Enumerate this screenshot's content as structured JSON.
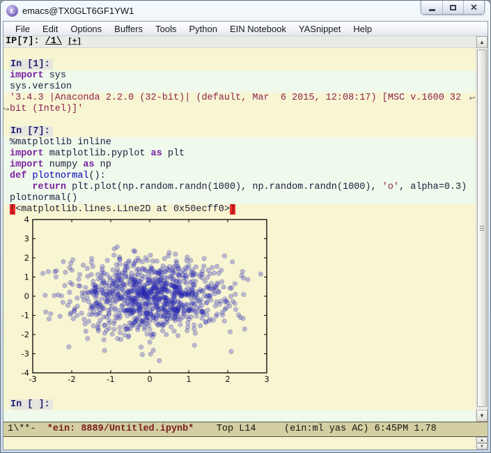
{
  "window": {
    "title": "emacs@TX0GLT6GF1YW1",
    "controls": [
      {
        "name": "minimize-button",
        "glyph": "minimize"
      },
      {
        "name": "maximize-button",
        "glyph": "maximize"
      },
      {
        "name": "close-button",
        "glyph": "close",
        "label": "X"
      }
    ]
  },
  "menu": {
    "items": [
      "File",
      "Edit",
      "Options",
      "Buffers",
      "Tools",
      "Python",
      "EIN Notebook",
      "YASnippet",
      "Help"
    ]
  },
  "header_line": {
    "prefix": "IP[7]: ",
    "kernel_link": "/1\\",
    "add_link": "[+]"
  },
  "buffer": {
    "rows": [
      {
        "type": "blank"
      },
      {
        "type": "prompt",
        "text": "In [1]:"
      },
      {
        "type": "input",
        "segs": [
          {
            "t": "import",
            "c": "kw"
          },
          {
            "t": " sys"
          }
        ]
      },
      {
        "type": "input",
        "segs": [
          {
            "t": "sys.version"
          }
        ]
      },
      {
        "type": "output",
        "segs": [
          {
            "t": "'3.4.3 |Anaconda 2.2.0 (32-bit)| (default, Mar  6 2015, 12:08:17) [MSC v.1600 32",
            "c": "str"
          }
        ],
        "wrap_right": true
      },
      {
        "type": "output",
        "segs": [
          {
            "t": "bit (Intel)]'",
            "c": "str"
          }
        ],
        "wrap_left": true
      },
      {
        "type": "blank"
      },
      {
        "type": "prompt",
        "text": "In [7]:"
      },
      {
        "type": "input",
        "segs": [
          {
            "t": "%matplotlib inline"
          }
        ]
      },
      {
        "type": "input",
        "segs": [
          {
            "t": "import",
            "c": "kw"
          },
          {
            "t": " matplotlib.pyplot "
          },
          {
            "t": "as",
            "c": "kw"
          },
          {
            "t": " plt"
          }
        ]
      },
      {
        "type": "input",
        "segs": [
          {
            "t": "import",
            "c": "kw"
          },
          {
            "t": " numpy "
          },
          {
            "t": "as",
            "c": "kw"
          },
          {
            "t": " np"
          }
        ]
      },
      {
        "type": "input",
        "segs": [
          {
            "t": "def",
            "c": "kw"
          },
          {
            "t": " "
          },
          {
            "t": "plotnormal",
            "c": "fn"
          },
          {
            "t": "():"
          }
        ]
      },
      {
        "type": "input",
        "segs": [
          {
            "t": "    "
          },
          {
            "t": "return",
            "c": "kw"
          },
          {
            "t": " plt.plot(np.random.randn(1000), np.random.randn(1000), "
          },
          {
            "t": "'o'",
            "c": "str"
          },
          {
            "t": ", alpha=0.3)"
          }
        ]
      },
      {
        "type": "input",
        "segs": [
          {
            "t": "plotnormal()"
          }
        ]
      },
      {
        "type": "output",
        "segs": [
          {
            "t": "[",
            "c": "paren"
          },
          {
            "t": "<matplotlib.lines.Line2D at 0x50ecff0>"
          },
          {
            "t": "]",
            "c": "paren"
          }
        ]
      },
      {
        "type": "image"
      },
      {
        "type": "blank"
      },
      {
        "type": "prompt",
        "text": "In [ ]:"
      },
      {
        "type": "input",
        "segs": [
          {
            "t": ""
          }
        ]
      }
    ],
    "wrap_glyph_left": "↪",
    "wrap_glyph_right": "↩"
  },
  "chart_data": {
    "type": "scatter",
    "title": "",
    "xlabel": "",
    "ylabel": "",
    "xlim": [
      -3,
      3
    ],
    "ylim": [
      -4,
      4
    ],
    "xticks": [
      -3,
      -2,
      -1,
      0,
      1,
      2,
      3
    ],
    "yticks": [
      -4,
      -3,
      -2,
      -1,
      0,
      1,
      2,
      3,
      4
    ],
    "grid": false,
    "legend": null,
    "n_points": 1000,
    "distribution": "standard_normal_xy",
    "mean": 0,
    "std": 1,
    "marker": "o",
    "alpha": 0.3,
    "marker_color": "#2b2bc4",
    "seed": 20150306
  },
  "modeline": {
    "prefix": "1\\**-  ",
    "buffer_id": "*ein: 8889/Untitled.ipynb*",
    "mid": "    Top L14     ",
    "right": "(ein:ml yas AC) 6:45PM 1.78"
  },
  "echo_area": {
    "text": ""
  },
  "colors": {
    "buffer-bg": "#f8f5d2",
    "input-bg": "#eff9ec",
    "prompt-bg": "#e6e6df",
    "prompt-fg": "#1f1f70",
    "code-fg": "#1d1d3c",
    "kw": "#7c1fa2",
    "fn": "#0000bb",
    "str": "#8b2252",
    "paren-bg": "#ee2a2a",
    "modeline-bg": "#d3cfa2",
    "buffer-id": "#7b1d1d"
  }
}
